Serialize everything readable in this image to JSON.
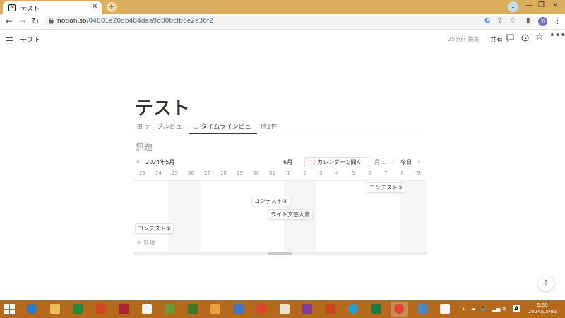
{
  "browser": {
    "tab_title": "テスト",
    "favicon_letter": "N",
    "tab_close": "✕",
    "new_tab": "+",
    "profile_down": "⌄",
    "window_controls": [
      "—",
      "❐",
      "✕"
    ],
    "url_host": "notion.so",
    "url_path": "/04801e20db484daa9d80bcfb6e2e36f2",
    "omnibox_icons": [
      "G",
      "⇪",
      "☆"
    ],
    "side_panel_icon": "▮",
    "avatar_initials": "新",
    "menu": "⋮"
  },
  "notion": {
    "breadcrumb": "テスト",
    "edited": "25分前 編集",
    "share": "共有",
    "icons": [
      "comment-icon",
      "history-icon",
      "star-icon",
      "more-icon"
    ],
    "page_title": "テスト",
    "views": [
      {
        "label": "テーブルビュー",
        "icon": "⊞"
      },
      {
        "label": "タイムラインビュー",
        "icon": "▭"
      },
      {
        "label": "他1件",
        "icon": ""
      }
    ],
    "database_title": "無題",
    "timeline": {
      "expand_icon": "»",
      "current_month": "2024年5月",
      "next_month": "6月",
      "open_calendar": "カレンダーで開く",
      "zoom": "月",
      "today": "今日",
      "days": [
        "23",
        "24",
        "25",
        "26",
        "27",
        "28",
        "29",
        "30",
        "31",
        "1",
        "2",
        "3",
        "4",
        "5",
        "6",
        "7",
        "8",
        "9"
      ],
      "items": [
        {
          "label": "コンテスト①"
        },
        {
          "label": "コンテスト②"
        },
        {
          "label": "ライト文芸大賞"
        },
        {
          "label": "コンテスト③"
        }
      ],
      "new_label": "新規"
    },
    "help": "?"
  },
  "taskbar": {
    "apps": [
      {
        "name": "internet-explorer",
        "color": "#1e7fd6"
      },
      {
        "name": "file-explorer",
        "color": "#e9c15a"
      },
      {
        "name": "excel-viewer",
        "color": "#1f8a3c"
      },
      {
        "name": "powerpoint",
        "color": "#d24726"
      },
      {
        "name": "toolbox",
        "color": "#a23"
      },
      {
        "name": "notepad",
        "color": "#f2f2f2"
      },
      {
        "name": "game-1",
        "color": "#6a9a3a"
      },
      {
        "name": "game-2",
        "color": "#3a7a2a"
      },
      {
        "name": "outlook",
        "color": "#e9a53a"
      },
      {
        "name": "cards",
        "color": "#3a78c8"
      },
      {
        "name": "chrome",
        "color": "#e34133"
      },
      {
        "name": "mail",
        "color": "#e7e1d0"
      },
      {
        "name": "onenote",
        "color": "#7e3a9e"
      },
      {
        "name": "red-app",
        "color": "#c42"
      },
      {
        "name": "edge",
        "color": "#1ea1d2"
      },
      {
        "name": "excel",
        "color": "#1d7a3e"
      },
      {
        "name": "chrome-active",
        "color": "#e34133"
      },
      {
        "name": "photos",
        "color": "#4a86c8"
      },
      {
        "name": "document",
        "color": "#f5f5f5"
      }
    ],
    "time": "5:59",
    "date": "2024/05/05",
    "ime": "A"
  }
}
